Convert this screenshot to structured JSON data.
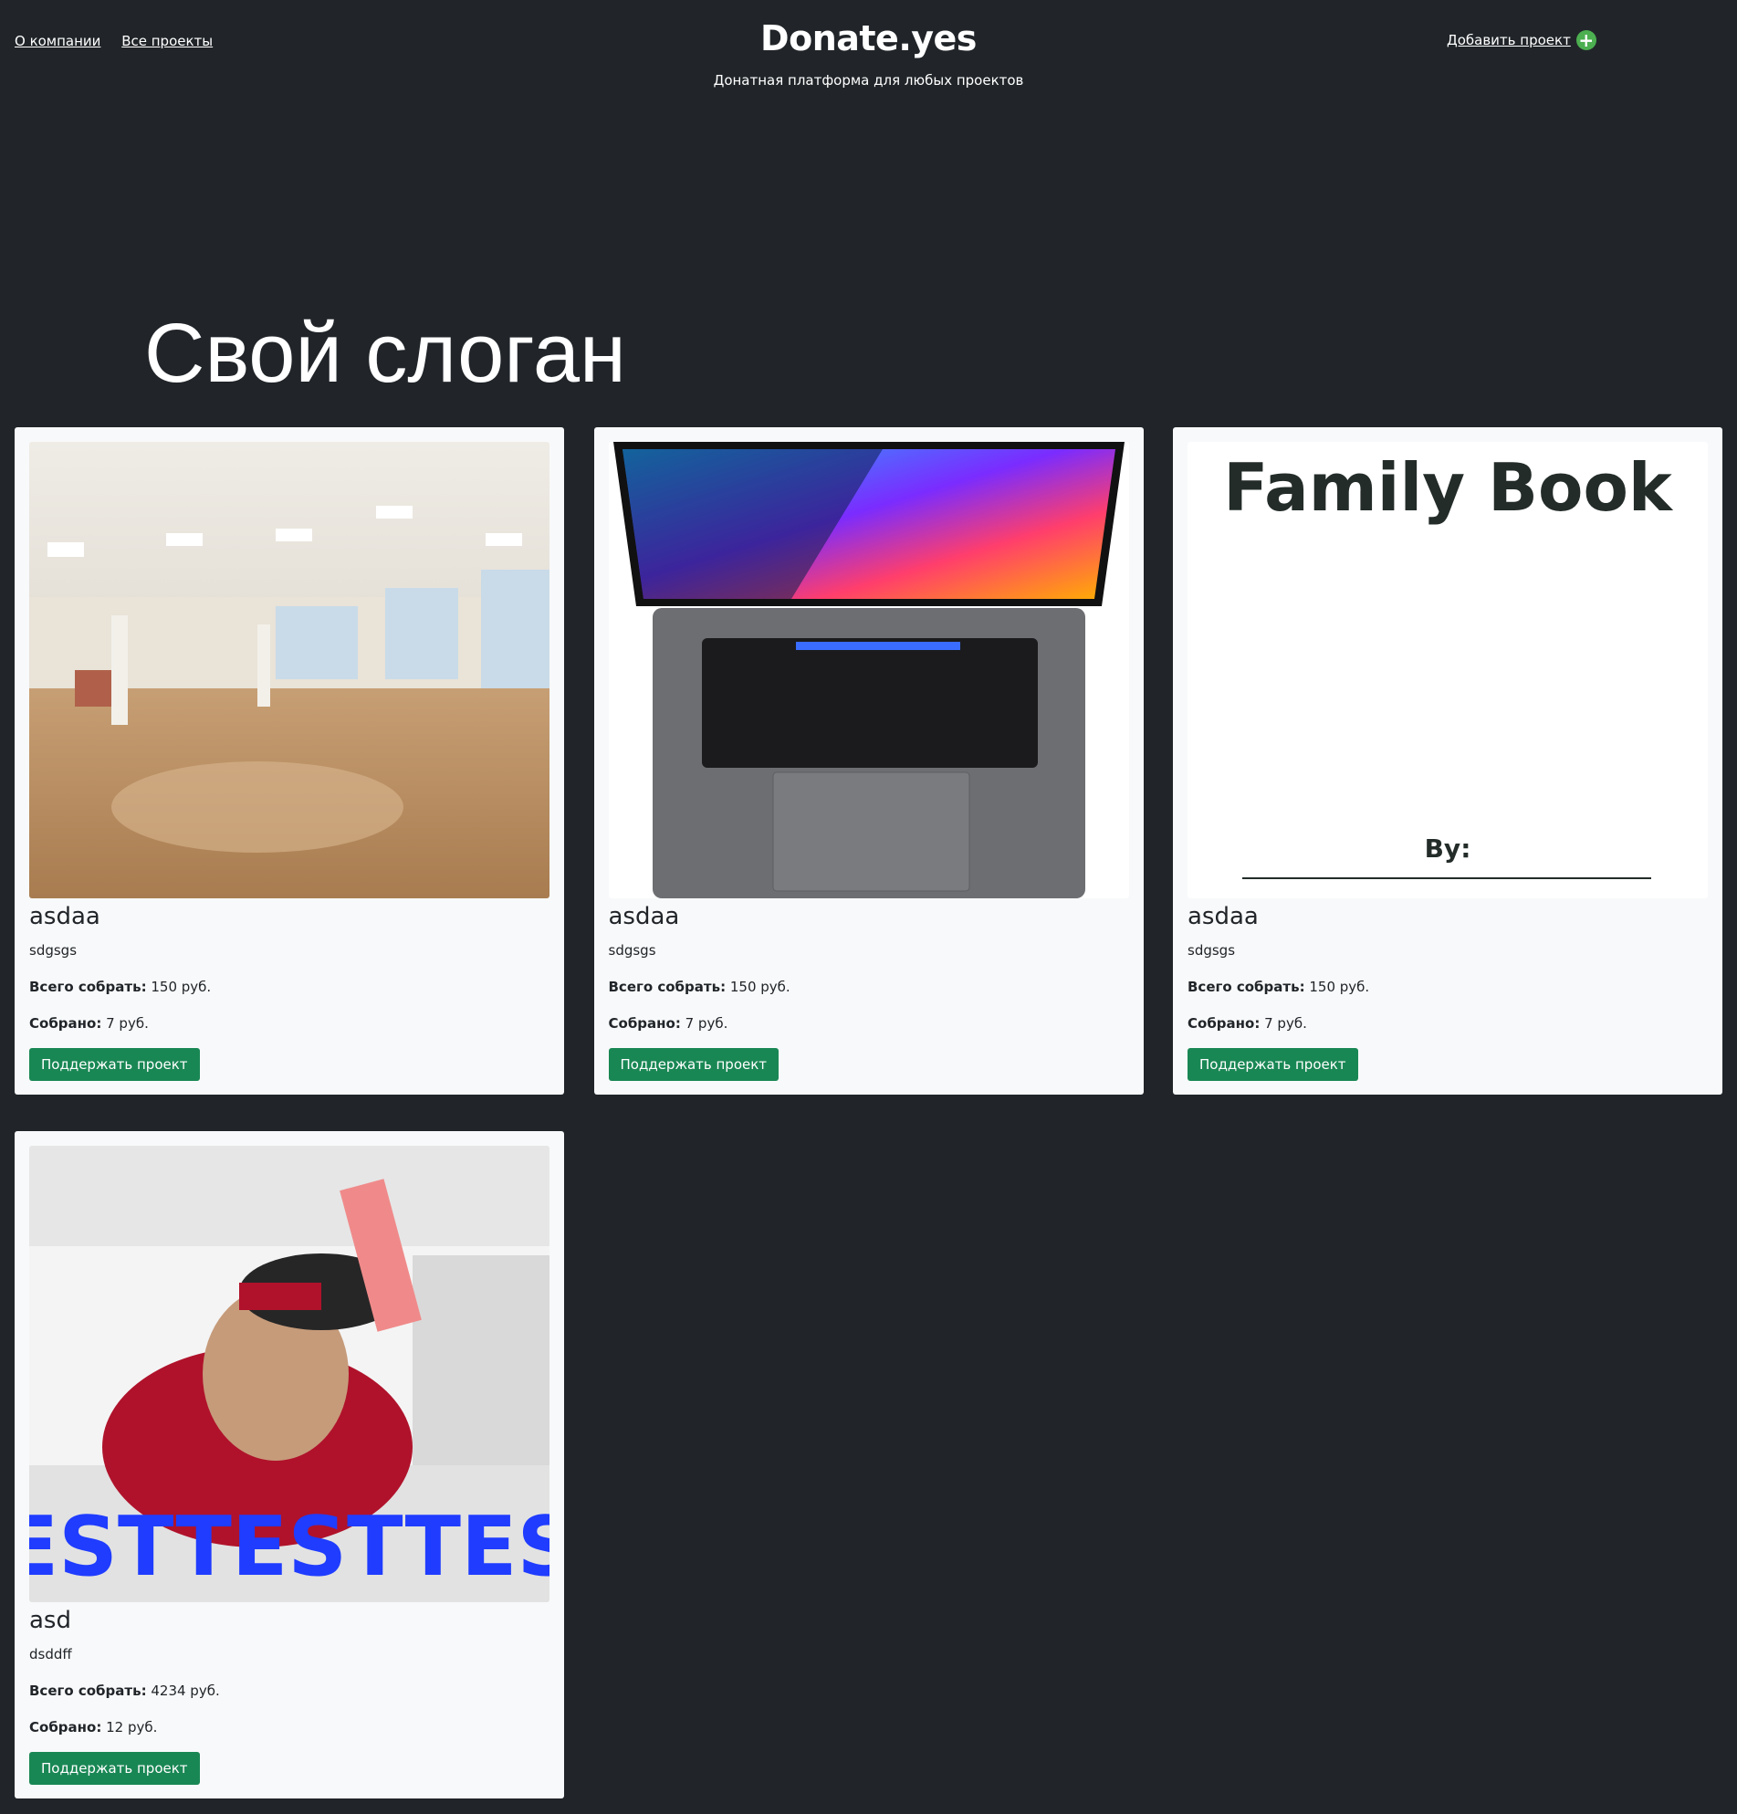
{
  "nav": {
    "about": "О компании",
    "all_projects": "Все проекты",
    "add_project": "Добавить проект"
  },
  "brand": {
    "name": "Donate.yes",
    "tagline": "Донатная платформа для любых проектов"
  },
  "hero": {
    "slogan": "Свой слоган"
  },
  "labels": {
    "total_label": "Всего собрать:",
    "collected_label": "Собрано:"
  },
  "projects": [
    {
      "title": "asdaa",
      "description": "sdgsgs",
      "total": "150 руб.",
      "collected": "7 руб.",
      "button": "Поддержать проект",
      "image": "dance-hall-photo"
    },
    {
      "title": "asdaa",
      "description": "sdgsgs",
      "total": "150 руб.",
      "collected": "7 руб.",
      "button": "Поддержать проект",
      "image": "laptop-photo"
    },
    {
      "title": "asdaa",
      "description": "sdgsgs",
      "total": "150 руб.",
      "collected": "7 руб.",
      "button": "Поддержать проект",
      "image": "family-book-cover",
      "image_text": "Family Book",
      "image_caption": "By:"
    },
    {
      "title": "asd",
      "description": "dsddff",
      "total": "4234 руб.",
      "collected": "12 руб.",
      "button": "Поддержать проект",
      "image": "racer-photo",
      "image_text": "ESTTESTTES"
    }
  ],
  "colors": {
    "background": "#212529",
    "card": "#f8f9fa",
    "button": "#198754",
    "plus_icon": "#4caf50"
  }
}
